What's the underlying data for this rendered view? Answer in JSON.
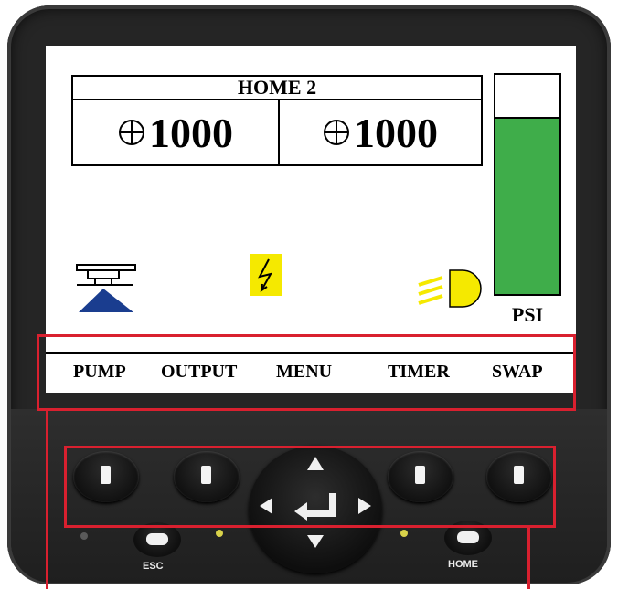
{
  "display": {
    "title": "HOME 2",
    "rate_left": "1000",
    "rate_right": "1000",
    "psi_label": "PSI",
    "psi_level": 0.8
  },
  "softkeys": [
    "PUMP",
    "OUTPUT",
    "MENU",
    "TIMER",
    "SWAP"
  ],
  "hardware": {
    "esc_label": "ESC",
    "home_label": "HOME"
  },
  "colors": {
    "psi_fill": "#3fad4a",
    "power_badge": "#f5e900",
    "light": "#f5e900",
    "spray": "#1a3d8f",
    "highlight": "#d9202f"
  },
  "icons": [
    "spray-nozzle-icon",
    "power-bolt-icon",
    "headlight-icon",
    "crosshair-icon"
  ]
}
